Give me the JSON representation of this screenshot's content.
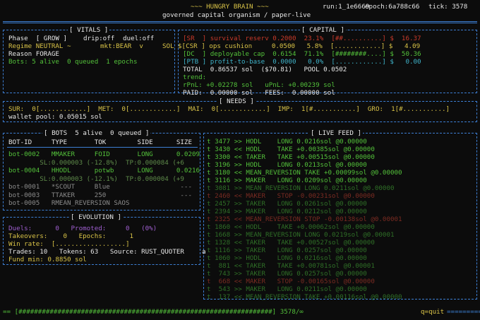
{
  "header": {
    "title": "~~~ HUNGRY BRAIN ~~~",
    "run": "run:1_1e6669",
    "epoch": "epoch:6a788c66",
    "tick": "tick: 3578",
    "subtitle": "governed capital organism / paper-live"
  },
  "vitals": {
    "title": "[ VITALS ]",
    "phase": "Phase  [ GROW ]",
    "drip": "drip:off",
    "duel": "duel:off",
    "regime": "Regime NEUTRAL ~",
    "mkt": "mkt:BEAR  v",
    "sol_tag": "SOL",
    "reason": "Reason FORAGE",
    "bots": "Bots: 5 alive  0 queued  1 epochs"
  },
  "capital": {
    "title": "[ CAPITAL ]",
    "rows": [
      {
        "tag": "[SR  ]",
        "name": "survival reserv",
        "ratio": "0.2000",
        "pct": "23.1%",
        "bar": "[##..........]",
        "usd": "$  16.37",
        "color": "red"
      },
      {
        "tag": "[CSR ]",
        "name": "ops cushion",
        "ratio": "0.0500",
        "pct": " 5.8%",
        "bar": "[............]",
        "usd": "$   4.09",
        "color": "yellow"
      },
      {
        "tag": "[DC  ]",
        "name": "deployable cap",
        "ratio": "0.6154",
        "pct": "71.1%",
        "bar": "[########....]",
        "usd": "$  50.36",
        "color": "green"
      },
      {
        "tag": "[PTB ]",
        "name": "profit-to-base",
        "ratio": "0.0000",
        "pct": " 0.0%",
        "bar": "[............]",
        "usd": "$   0.00",
        "color": "cyan"
      }
    ],
    "total": "TOTAL  0.86537 sol  ($70.81)   POOL 0.0502",
    "trend_label": "trend:",
    "rpnl": "rPnL: +0.02278 sol   uPnL: +0.00239 sol",
    "paid": "PAID:  0.00000 sol   FEES:  0.00000 sol"
  },
  "needs": {
    "title": "[ NEEDS ]",
    "line": "SUR:  0[............]  MET:  0[............]  MAI:  0[............]  IMP:  1[#...........]  GRO:  1[#...........]",
    "wallet": "wallet pool: 0.05015 sol"
  },
  "bots": {
    "title": "[ BOTS  5 alive  0 queued ]",
    "columns": "BOT-ID     TYPE       TOK        SIDE      SIZE",
    "lines": [
      {
        "text": "bot-0002   MMAKER     FOID       LONG      0.0209",
        "color": "green"
      },
      {
        "text": "        SL:0.000003 (-12.8%)  TP:0.000084 (+6",
        "color": "dim"
      },
      {
        "text": "bot-0004   HHODL      potwb      LONG      0.0216",
        "color": "green"
      },
      {
        "text": "        SL:0.000003 (-12.1%)  TP:0.000004 (+9",
        "color": "dim"
      },
      {
        "text": "bot-0001   *SCOUT     Blue                  ---",
        "color": "grey"
      },
      {
        "text": "bot-0003   TTAKER     250                   ---",
        "color": "grey"
      },
      {
        "text": "bot-0005   RMEAN_REVERSION SAOS                 ",
        "color": "grey"
      }
    ]
  },
  "evolution": {
    "title": "[ EVOLUTION ]",
    "duels": "Duels:      0   Promoted:     0   (0%)",
    "takeovers": "Takeovers:    0   Epochs:      1",
    "winrate": "Win rate:  [..................]",
    "trades": "Trades: 10   Tokens: 63   Source: RUST_QUOTER",
    "fundmin": "Fund min: 0.8850 sol"
  },
  "feed": {
    "title": "[ LIVE FEED ]",
    "cursor": "a",
    "lines": [
      {
        "text": "t 3477 >> HODL    LONG 0.0216sol @0.00000",
        "color": "green"
      },
      {
        "text": "t 3430 << HODL    TAKE +0.00385sol @0.00000",
        "color": "green"
      },
      {
        "text": "t 3300 << TAKER   TAKE +0.00515sol @0.00000",
        "color": "green"
      },
      {
        "text": "t 3196 >> HODL    LONG 0.0213sol @0.00000",
        "color": "green"
      },
      {
        "text": "t 3180 << MEAN_REVERSION TAKE +0.00099sol @0.00000",
        "color": "green"
      },
      {
        "text": "t 3116 >> MAKER   LONG 0.0209sol @0.00000",
        "color": "green"
      },
      {
        "text": "t 3081 >> MEAN_REVERSION LONG 0.0211sol @0.00000",
        "color": "dgreen"
      },
      {
        "text": "t 2460 << MAKER   STOP -0.00231sol @0.00000",
        "color": "dred"
      },
      {
        "text": "t 2457 >> TAKER   LONG 0.0261sol @0.00000",
        "color": "dgreen"
      },
      {
        "text": "t 2394 >> MAKER   LONG 0.0212sol @0.00000",
        "color": "dgreen"
      },
      {
        "text": "t 2325 << MEAN_REVERSION STOP -0.00138sol @0.00001",
        "color": "dred"
      },
      {
        "text": "t 1860 << HODL    TAKE +0.00062sol @0.00000",
        "color": "dgreen"
      },
      {
        "text": "t 1668 >> MEAN_REVERSION LONG 0.0219sol @0.00001",
        "color": "dgreen"
      },
      {
        "text": "t 1328 << TAKER   TAKE +0.00527sol @0.00000",
        "color": "dgreen"
      },
      {
        "text": "t 1116 >> TAKER   LONG 0.0257sol @0.00000",
        "color": "dgreen"
      },
      {
        "text": "t 1060 >> HODL    LONG 0.0216sol @0.00000",
        "color": "dgreen"
      },
      {
        "text": "t  881 << TAKER   TAKE +0.00781sol @0.00001",
        "color": "dgreen"
      },
      {
        "text": "t  743 >> TAKER   LONG 0.0257sol @0.00000",
        "color": "dgreen"
      },
      {
        "text": "t  668 << MAKER   STOP -0.00165sol @0.00000",
        "color": "dred"
      },
      {
        "text": "t  543 >> MAKER   LONG 0.0211sol @0.00000",
        "color": "dgreen"
      },
      {
        "text": "t  137 << MEAN_REVERSION TAKE +0.00116sol @0.00000",
        "color": "dgreen"
      }
    ]
  },
  "footer": {
    "progress_bar": "== [#################################################################] 3578/∞",
    "progress_fraction": 1.0,
    "quit": "q=quit",
    "tail": "========="
  }
}
